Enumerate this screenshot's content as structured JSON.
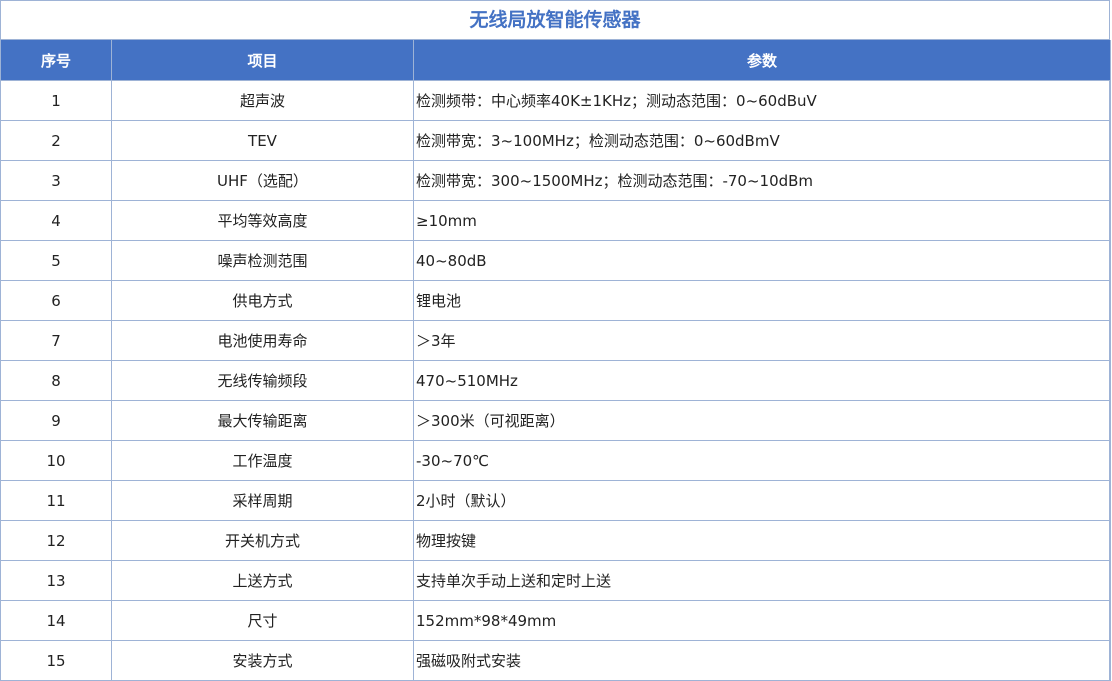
{
  "title": "无线局放智能传感器",
  "headers": {
    "num": "序号",
    "item": "项目",
    "param": "参数"
  },
  "rows": [
    {
      "num": "1",
      "item": "超声波",
      "param": "检测频带：中心频率40K±1KHz；测动态范围：0~60dBuV"
    },
    {
      "num": "2",
      "item": "TEV",
      "param": "检测带宽：3~100MHz；检测动态范围：0~60dBmV"
    },
    {
      "num": "3",
      "item": "UHF（选配）",
      "param": "检测带宽：300~1500MHz；检测动态范围：-70~10dBm"
    },
    {
      "num": "4",
      "item": "平均等效高度",
      "param": "≥10mm"
    },
    {
      "num": "5",
      "item": "噪声检测范围",
      "param": "40~80dB"
    },
    {
      "num": "6",
      "item": "供电方式",
      "param": "锂电池"
    },
    {
      "num": "7",
      "item": "电池使用寿命",
      "param": "＞3年"
    },
    {
      "num": "8",
      "item": "无线传输频段",
      "param": "470~510MHz"
    },
    {
      "num": "9",
      "item": "最大传输距离",
      "param": "＞300米（可视距离）"
    },
    {
      "num": "10",
      "item": "工作温度",
      "param": "-30~70℃"
    },
    {
      "num": "11",
      "item": "采样周期",
      "param": "2小时（默认）"
    },
    {
      "num": "12",
      "item": "开关机方式",
      "param": "物理按键"
    },
    {
      "num": "13",
      "item": "上送方式",
      "param": "支持单次手动上送和定时上送"
    },
    {
      "num": "14",
      "item": "尺寸",
      "param": "152mm*98*49mm"
    },
    {
      "num": "15",
      "item": "安装方式",
      "param": "强磁吸附式安装"
    }
  ],
  "colors": {
    "header_bg": "#4472c4",
    "title_text": "#4472c4",
    "grid_line": "#9eb3d6"
  }
}
